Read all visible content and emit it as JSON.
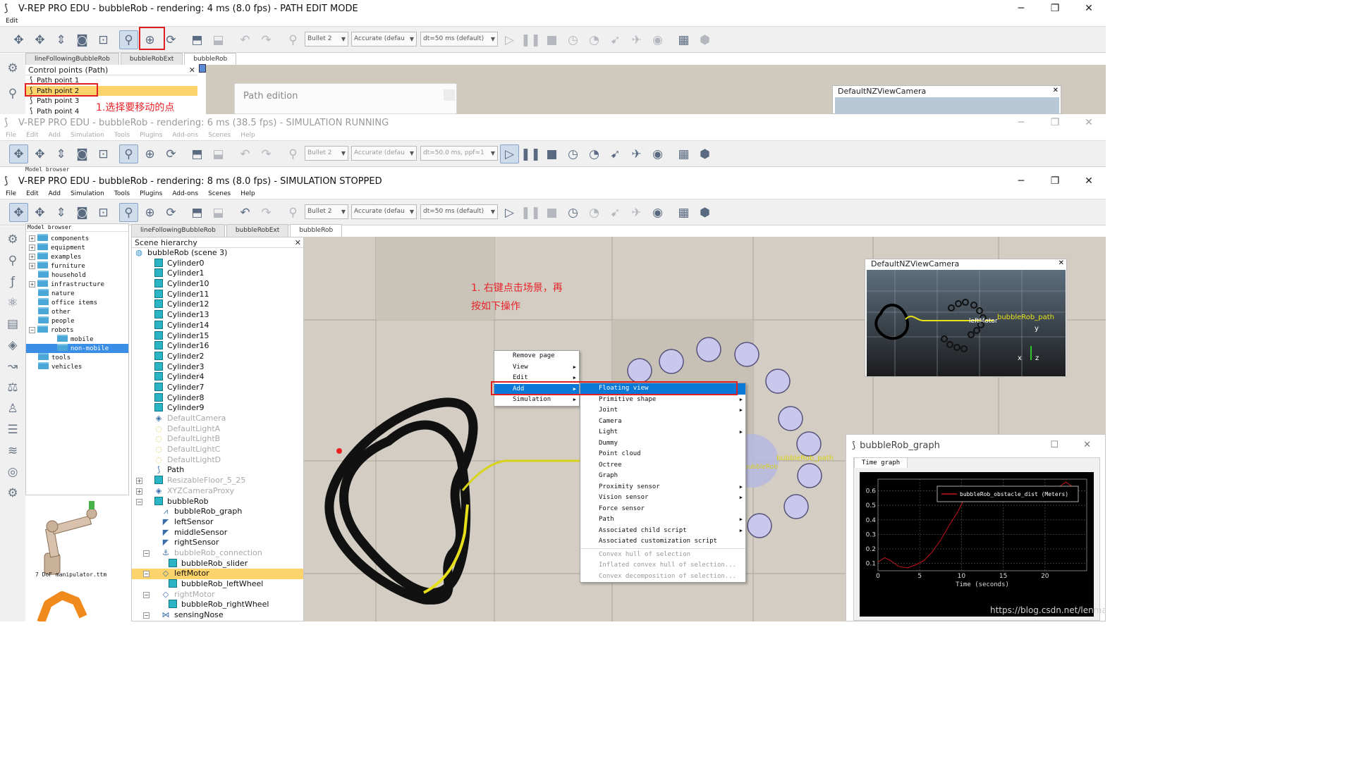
{
  "win1": {
    "title": "V-REP PRO EDU - bubbleRob - rendering: 4 ms (8.0 fps) - PATH EDIT MODE",
    "menu": [
      "Edit"
    ],
    "combos": [
      "Bullet 2",
      "Accurate (defau",
      "dt=50 ms (default)"
    ],
    "tabs": [
      "lineFollowingBubbleRob",
      "bubbleRobExt",
      "bubbleRob"
    ],
    "control_points_header": "Control points (Path)",
    "control_points": [
      "Path point 1",
      "Path point 2",
      "Path point 3",
      "Path point 4"
    ],
    "annotation": "1.选择要移动的点",
    "path_edition_title": "Path edition",
    "camera_title": "DefaultNZViewCamera"
  },
  "win2": {
    "title": "V-REP PRO EDU - bubbleRob - rendering: 6 ms (38.5 fps) - SIMULATION RUNNING",
    "menu": [
      "File",
      "Edit",
      "Add",
      "Simulation",
      "Tools",
      "Plugins",
      "Add-ons",
      "Scenes",
      "Help"
    ],
    "combos": [
      "Bullet 2",
      "Accurate (defau",
      "dt=50.0 ms, ppf=1"
    ],
    "model_browser_label": "Model browser"
  },
  "win3": {
    "title": "V-REP PRO EDU - bubbleRob - rendering: 8 ms (8.0 fps) - SIMULATION STOPPED",
    "menu": [
      "File",
      "Edit",
      "Add",
      "Simulation",
      "Tools",
      "Plugins",
      "Add-ons",
      "Scenes",
      "Help"
    ],
    "combos": [
      "Bullet 2",
      "Accurate (defau",
      "dt=50 ms (default)"
    ],
    "tabs": [
      "lineFollowingBubbleRob",
      "bubbleRobExt",
      "bubbleRob"
    ],
    "model_browser": {
      "header": "Model browser",
      "items": [
        {
          "label": "components",
          "expander": "+"
        },
        {
          "label": "equipment",
          "expander": "+"
        },
        {
          "label": "examples",
          "expander": "+"
        },
        {
          "label": "furniture",
          "expander": "+"
        },
        {
          "label": "household",
          "expander": ""
        },
        {
          "label": "infrastructure",
          "expander": "+"
        },
        {
          "label": "nature",
          "expander": ""
        },
        {
          "label": "office items",
          "expander": ""
        },
        {
          "label": "other",
          "expander": ""
        },
        {
          "label": "people",
          "expander": ""
        },
        {
          "label": "robots",
          "expander": "−"
        },
        {
          "label": "mobile",
          "expander": ""
        },
        {
          "label": "non-mobile",
          "expander": ""
        },
        {
          "label": "tools",
          "expander": ""
        },
        {
          "label": "vehicles",
          "expander": ""
        }
      ],
      "thumbnail_label": "7 DoF manipulator.ttm"
    },
    "hierarchy": {
      "header": "Scene hierarchy",
      "rows": [
        "bubbleRob (scene 3)",
        "Cylinder0",
        "Cylinder1",
        "Cylinder10",
        "Cylinder11",
        "Cylinder12",
        "Cylinder13",
        "Cylinder14",
        "Cylinder15",
        "Cylinder16",
        "Cylinder2",
        "Cylinder3",
        "Cylinder4",
        "Cylinder7",
        "Cylinder8",
        "Cylinder9",
        "DefaultCamera",
        "DefaultLightA",
        "DefaultLightB",
        "DefaultLightC",
        "DefaultLightD",
        "Path",
        "ResizableFloor_5_25",
        "XYZCameraProxy",
        "bubbleRob",
        "bubbleRob_graph",
        "leftSensor",
        "middleSensor",
        "rightSensor",
        "bubbleRob_connection",
        "bubbleRob_slider",
        "leftMotor",
        "bubbleRob_leftWheel",
        "rightMotor",
        "bubbleRob_rightWheel",
        "sensingNose"
      ]
    },
    "annotation_line1": "1. 右键点击场景，再",
    "annotation_line2": "按如下操作",
    "context_menu": [
      "Remove page",
      "View",
      "Edit",
      "Add",
      "Simulation"
    ],
    "add_submenu": [
      "Floating view",
      "Primitive shape",
      "Joint",
      "Camera",
      "Light",
      "Dummy",
      "Point cloud",
      "Octree",
      "Graph",
      "Proximity sensor",
      "Vision sensor",
      "Force sensor",
      "Path",
      "Associated child script",
      "Associated customization script",
      "Convex hull of selection",
      "Inflated convex hull of selection...",
      "Convex decomposition of selection..."
    ],
    "camera_view": {
      "title": "DefaultNZViewCamera",
      "path_label": "bubbleRob_path",
      "motor_label": "leftMotor",
      "axes": [
        "y",
        "x",
        "z"
      ]
    },
    "graph_window": {
      "title": "bubbleRob_graph",
      "tab": "Time graph",
      "legend": "bubbleRob_obstacle_dist (Meters)",
      "xlabel": "Time (seconds)",
      "xticks": [
        "0",
        "5",
        "10",
        "15",
        "20"
      ],
      "yticks": [
        "0.1",
        "0.2",
        "0.3",
        "0.4",
        "0.5",
        "0.6"
      ]
    },
    "scene_labels": [
      "bubbleRob_path",
      "bubbleRob"
    ],
    "watermark": "https://blog.csdn.net/lenman"
  },
  "chart_data": {
    "type": "line",
    "title": "",
    "xlabel": "Time (seconds)",
    "ylabel": "",
    "xlim": [
      0,
      25
    ],
    "ylim": [
      0.05,
      0.68
    ],
    "series": [
      {
        "name": "bubbleRob_obstacle_dist (Meters)",
        "x": [
          0,
          0.8,
          1.5,
          2.5,
          3.5,
          4.5,
          5.5,
          6.5,
          7.5,
          8.5,
          9.5,
          10.5,
          11.5,
          12.5,
          13.5,
          14.5,
          15.5,
          16.5,
          17.5,
          18.5,
          19.5,
          20.5,
          21.5,
          22.5,
          23.5
        ],
        "y": [
          0.11,
          0.14,
          0.12,
          0.08,
          0.07,
          0.09,
          0.12,
          0.18,
          0.26,
          0.36,
          0.45,
          0.56,
          0.6,
          0.55,
          0.53,
          0.55,
          0.58,
          0.61,
          0.62,
          0.62,
          0.63,
          0.63,
          0.62,
          0.66,
          0.62
        ]
      }
    ]
  }
}
